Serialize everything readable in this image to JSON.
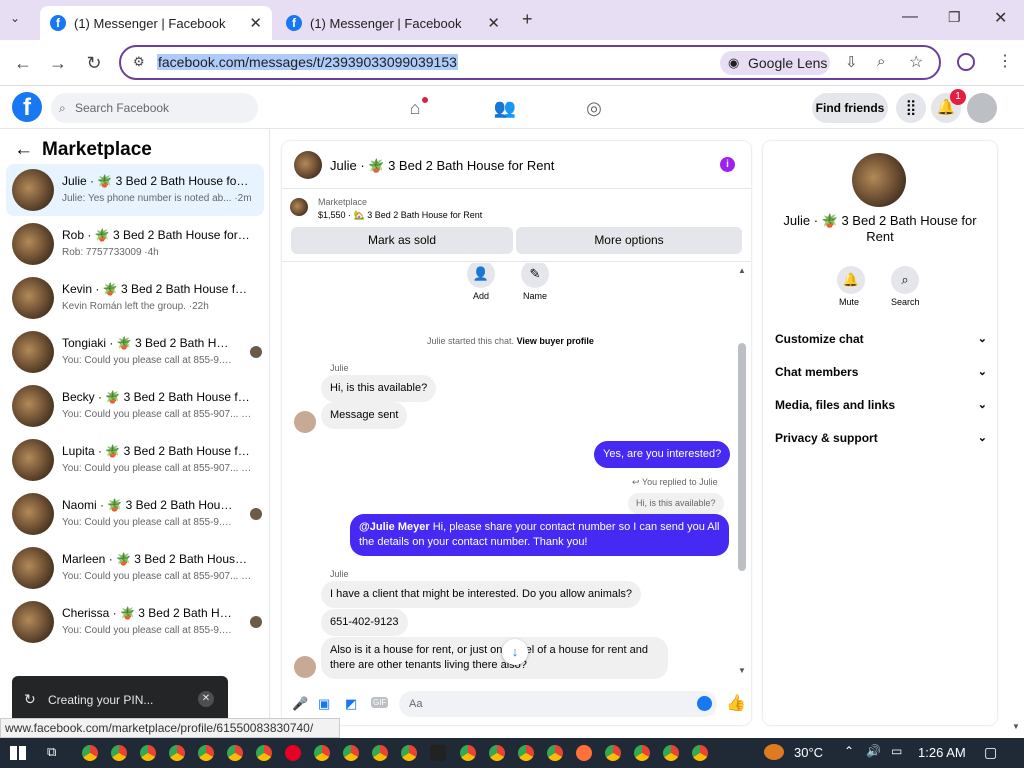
{
  "browser": {
    "tabs": [
      {
        "title": "(1) Messenger | Facebook",
        "active": true
      },
      {
        "title": "(1) Messenger | Facebook",
        "active": false
      }
    ],
    "url": "facebook.com/messages/t/23939033099039153",
    "lens_label": "Google Lens"
  },
  "fb_header": {
    "search_placeholder": "Search Facebook",
    "find_friends": "Find friends",
    "notif_count": "1"
  },
  "sidebar": {
    "title": "Marketplace",
    "conversations": [
      {
        "name": "Julie · 🪴 3 Bed 2 Bath House for Rent",
        "preview": "Julie: Yes phone number is noted ab... ·2m",
        "selected": true
      },
      {
        "name": "Rob · 🪴 3 Bed 2 Bath House for Rent",
        "preview": "Rob: 7757733009 ·4h"
      },
      {
        "name": "Kevin · 🪴 3 Bed 2 Bath House for Rent",
        "preview": "Kevin Román left the group. ·22h"
      },
      {
        "name": "Tongiaki · 🪴 3 Bed 2 Bath House for Rent",
        "preview": "You: Could you please call at 855-9... ·1d"
      },
      {
        "name": "Becky · 🪴 3 Bed 2 Bath House for Rent",
        "preview": "You: Could you please call at 855-907... ·1d"
      },
      {
        "name": "Lupita · 🪴 3 Bed 2 Bath House for Rent",
        "preview": "You: Could you please call at 855-907... ·1d"
      },
      {
        "name": "Naomi · 🪴 3 Bed 2 Bath House for Rent",
        "preview": "You: Could you please call at 855-9... ·1d"
      },
      {
        "name": "Marleen · 🪴 3 Bed 2 Bath House for Rent",
        "preview": "You: Could you please call at 855-907... ·1d"
      },
      {
        "name": "Cherissa · 🪴 3 Bed 2 Bath House for Rent",
        "preview": "You: Could you please call at 855-9... ·1d"
      }
    ],
    "toast": "Creating your PIN..."
  },
  "chat": {
    "title": "Julie · 🪴 3 Bed 2 Bath House for Rent",
    "listing_source": "Marketplace",
    "listing_line": "$1,550 · 🏡 3 Bed 2 Bath House for Rent",
    "mark_sold": "Mark as sold",
    "more_options": "More options",
    "add_label": "Add",
    "name_label": "Name",
    "started_text": "Julie started this chat.",
    "view_buyer": "View buyer profile",
    "sender1": "Julie",
    "msg1": "Hi, is this available?",
    "msg2": "Message sent",
    "out1": "Yes, are you interested?",
    "replied_to": "You replied to Julie",
    "quoted": "Hi, is this available?",
    "out2_mention": "@Julie Meyer",
    "out2_text": " Hi, please share your contact number so I can send you All the details on your contact number. Thank you!",
    "sender2": "Julie",
    "msg3": "I have a client that might be interested. Do you allow animals?",
    "msg4": "651-402-9123",
    "msg5": "Also is it a house for rent, or just one level of a house for rent and there are other tenants living there also?",
    "composer_placeholder": "Aa"
  },
  "details": {
    "title": "Julie · 🪴 3 Bed 2 Bath House for Rent",
    "mute": "Mute",
    "search": "Search",
    "sections": [
      "Customize chat",
      "Chat members",
      "Media, files and links",
      "Privacy & support"
    ]
  },
  "status_url": "www.facebook.com/marketplace/profile/61550083830740/",
  "taskbar": {
    "temp": "30°C",
    "time": "1:26 AM"
  }
}
